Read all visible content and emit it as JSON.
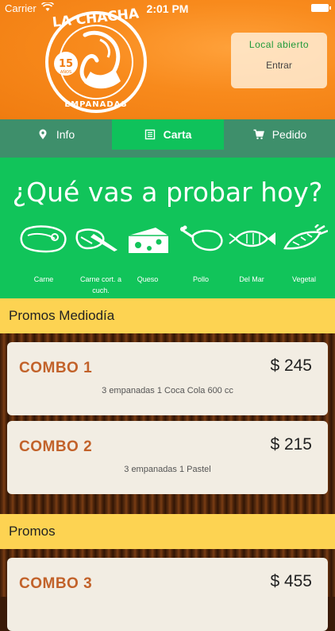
{
  "status_bar": {
    "carrier": "Carrier",
    "time": "2:01 PM"
  },
  "brand": {
    "name": "LA CHACHA",
    "years": "15",
    "years_word": "AÑOS",
    "subtitle": "EMPANADAS"
  },
  "store": {
    "status": "Local abierto",
    "enter": "Entrar"
  },
  "tabs": [
    {
      "label": "Info",
      "icon": "pin-icon"
    },
    {
      "label": "Carta",
      "icon": "menu-list-icon",
      "active": true
    },
    {
      "label": "Pedido",
      "icon": "cart-icon"
    }
  ],
  "banner": {
    "title": "¿Qué vas a probar hoy?",
    "categories": [
      {
        "label": "Carne",
        "icon": "steak-icon"
      },
      {
        "label": "Carne cort. a cuch.",
        "icon": "knife-meat-icon"
      },
      {
        "label": "Queso",
        "icon": "cheese-icon"
      },
      {
        "label": "Pollo",
        "icon": "chicken-icon"
      },
      {
        "label": "Del Mar",
        "icon": "fish-icon"
      },
      {
        "label": "Vegetal",
        "icon": "vegetable-icon"
      }
    ]
  },
  "sections": [
    {
      "title": "Promos Mediodía",
      "items": [
        {
          "name": "COMBO 1",
          "price": "$ 245",
          "description": "3 empanadas 1 Coca Cola 600 cc"
        },
        {
          "name": "COMBO 2",
          "price": "$ 215",
          "description": "3 empanadas 1 Pastel"
        }
      ]
    },
    {
      "title": "Promos",
      "items": [
        {
          "name": "COMBO 3",
          "price": "$ 455"
        }
      ]
    }
  ],
  "colors": {
    "header": "#f88a1c",
    "tabs": "#3e8f6b",
    "active_tab": "#0fc25b",
    "banner": "#11c45a",
    "section": "#fdd352",
    "combo_name": "#c2622a"
  }
}
